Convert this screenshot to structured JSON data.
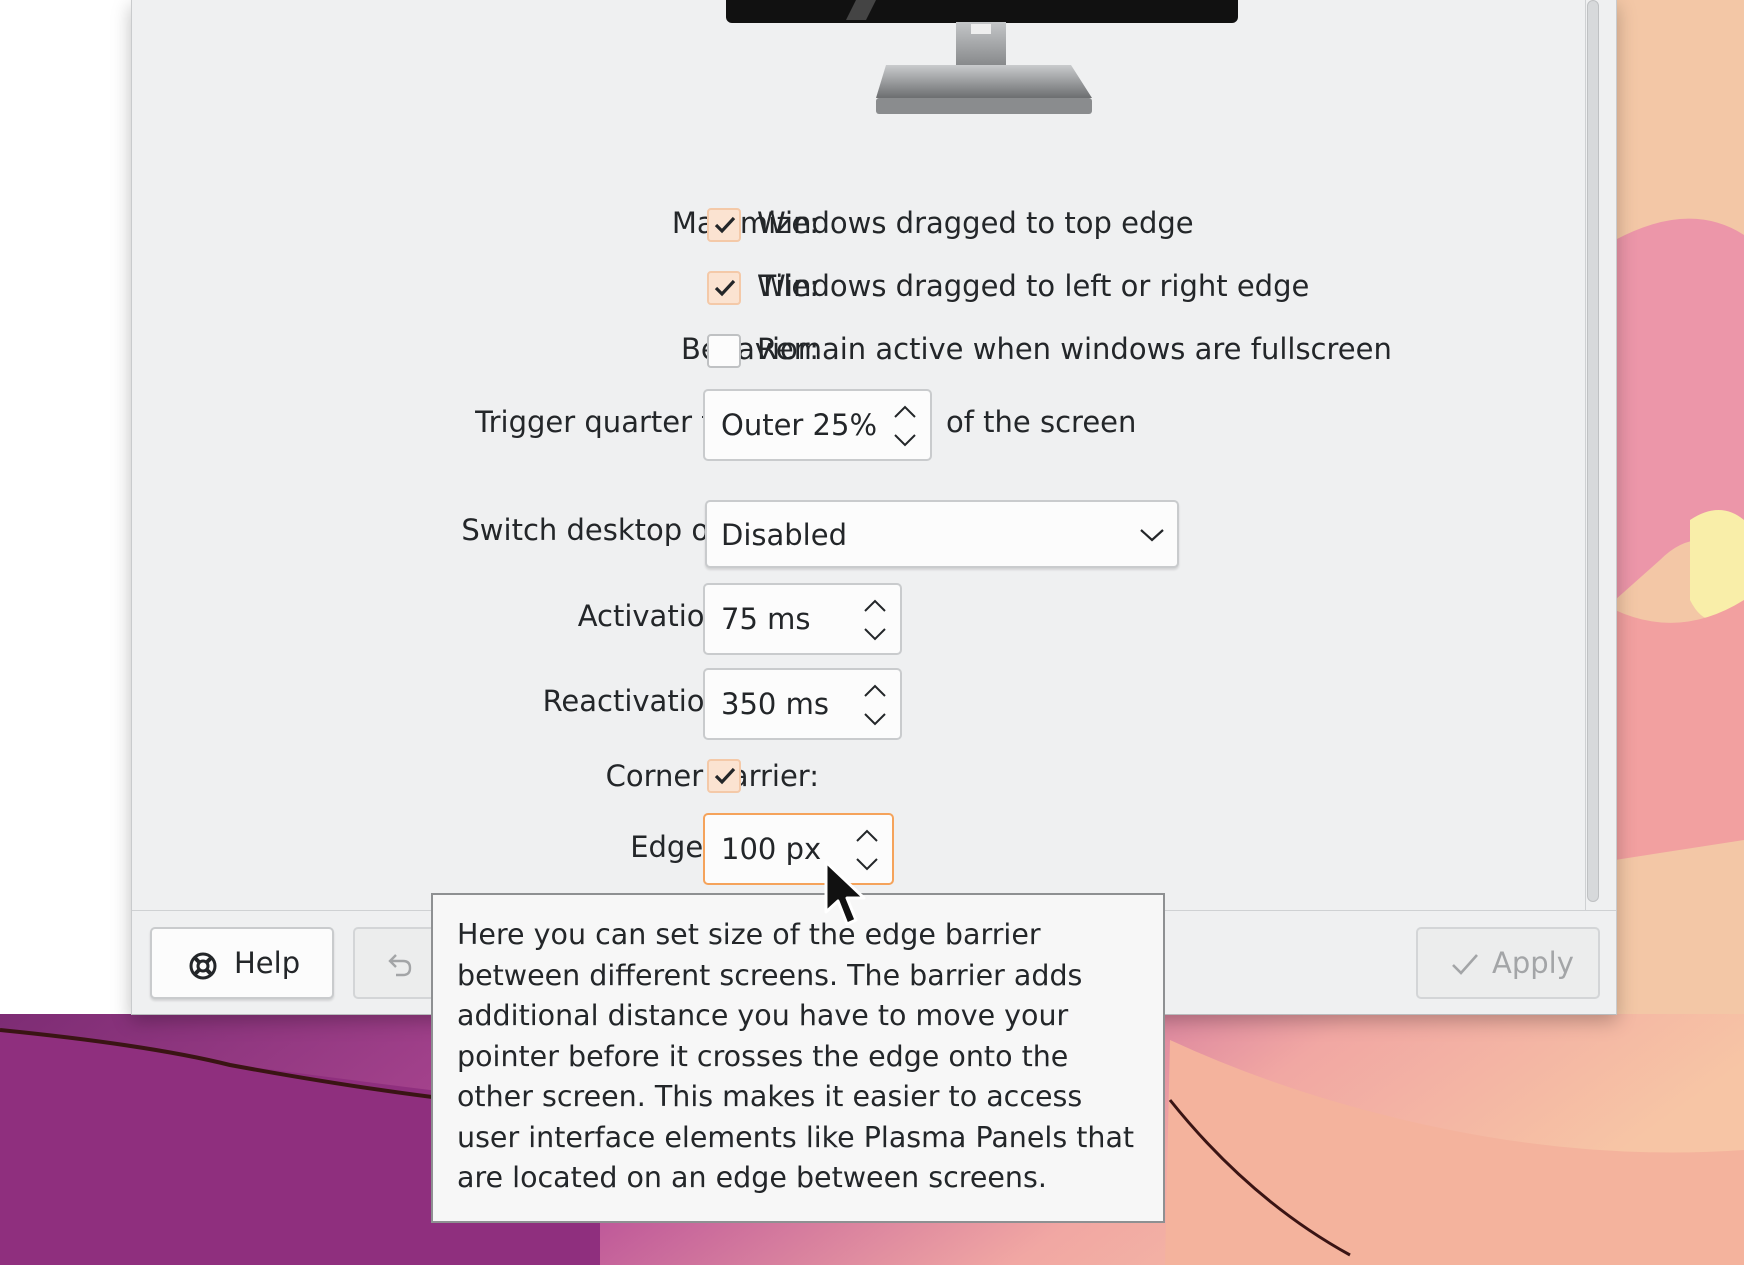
{
  "form": {
    "maximize": {
      "label": "Maximize:",
      "checked": true,
      "text": "Windows dragged to top edge"
    },
    "tile": {
      "label": "Tile:",
      "checked": true,
      "text": "Windows dragged to left or right edge"
    },
    "behavior": {
      "label": "Behavior:",
      "checked": false,
      "text": "Remain active when windows are fullscreen"
    },
    "quarter_tiling": {
      "label": "Trigger quarter tiling in:",
      "value": "Outer 25%",
      "suffix": "of the screen"
    },
    "switch_desktop": {
      "label": "Switch desktop on edge:",
      "value": "Disabled"
    },
    "activation_delay": {
      "label": "Activation delay:",
      "value": "75 ms"
    },
    "reactivation_delay": {
      "label": "Reactivation delay:",
      "value": "350 ms"
    },
    "corner_barrier": {
      "label": "Corner barrier:",
      "checked": true
    },
    "edge_barrier": {
      "label": "Edge barrier:",
      "value": "100 px"
    }
  },
  "footer": {
    "help_label": "Help",
    "apply_label": "Apply"
  },
  "tooltip": {
    "text": "Here you can set size of the edge barrier between different screens. The barrier adds additional distance you have to move your pointer before it crosses the edge onto the other screen. This makes it easier to access user interface elements like Plasma Panels that are located on an edge between screens."
  },
  "icons": {
    "help": "help-lifebuoy-icon",
    "reset": "undo-icon",
    "apply": "checkmark-icon",
    "dropdown": "chevron-down-icon",
    "spin": "spin-arrows-icon",
    "cursor": "mouse-pointer-icon"
  },
  "colors": {
    "window_bg": "#eff0f1",
    "check_bg": "#fbe3d1",
    "focus_border": "#f5a35b",
    "tooltip_bg": "#f7f7f7"
  }
}
